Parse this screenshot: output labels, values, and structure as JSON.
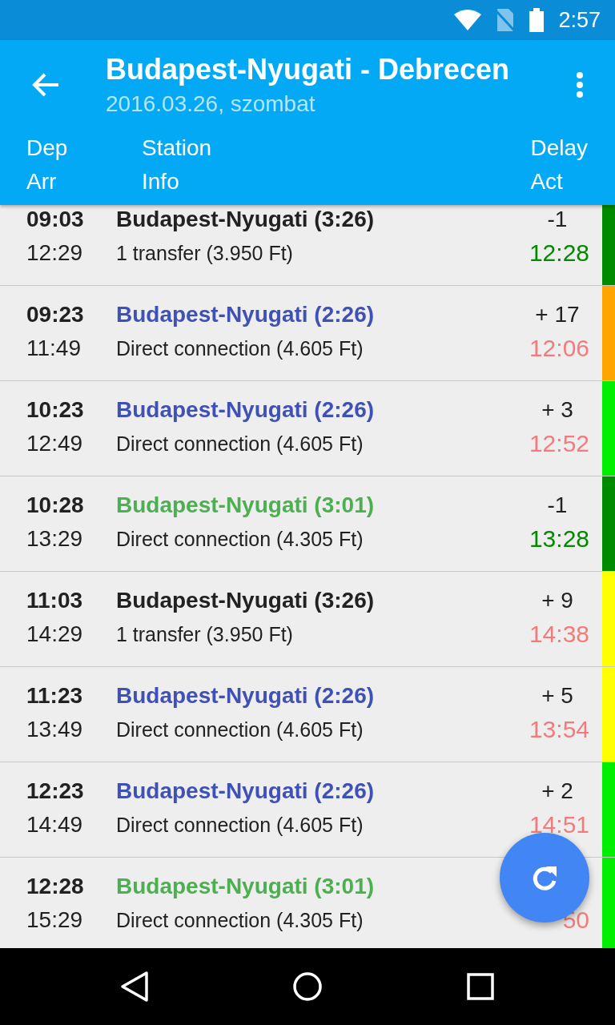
{
  "status_bar": {
    "time": "2:57"
  },
  "toolbar": {
    "title": "Budapest-Nyugati - Debrecen",
    "subtitle": "2016.03.26, szombat"
  },
  "columns": {
    "dep": "Dep",
    "arr": "Arr",
    "station": "Station",
    "info": "Info",
    "delay": "Delay",
    "act": "Act"
  },
  "rows": [
    {
      "dep": "09:03",
      "arr": "12:29",
      "station": "Budapest-Nyugati (3:26)",
      "kind": "neutral",
      "info": "1 transfer (3.950 Ft)",
      "delay": "-1",
      "act": "12:28",
      "late": false,
      "color": "#008a00"
    },
    {
      "dep": "09:23",
      "arr": "11:49",
      "station": "Budapest-Nyugati (2:26)",
      "kind": "blue",
      "info": "Direct connection (4.605 Ft)",
      "delay": "+ 17",
      "act": "12:06",
      "late": true,
      "color": "#ffa500"
    },
    {
      "dep": "10:23",
      "arr": "12:49",
      "station": "Budapest-Nyugati (2:26)",
      "kind": "blue",
      "info": "Direct connection (4.605 Ft)",
      "delay": "+ 3",
      "act": "12:52",
      "late": true,
      "color": "#00ee00"
    },
    {
      "dep": "10:28",
      "arr": "13:29",
      "station": "Budapest-Nyugati (3:01)",
      "kind": "green",
      "info": "Direct connection (4.305 Ft)",
      "delay": "-1",
      "act": "13:28",
      "late": false,
      "color": "#008a00"
    },
    {
      "dep": "11:03",
      "arr": "14:29",
      "station": "Budapest-Nyugati (3:26)",
      "kind": "neutral",
      "info": "1 transfer (3.950 Ft)",
      "delay": "+ 9",
      "act": "14:38",
      "late": true,
      "color": "#ffff00"
    },
    {
      "dep": "11:23",
      "arr": "13:49",
      "station": "Budapest-Nyugati (2:26)",
      "kind": "blue",
      "info": "Direct connection (4.605 Ft)",
      "delay": "+ 5",
      "act": "13:54",
      "late": true,
      "color": "#ffff00"
    },
    {
      "dep": "12:23",
      "arr": "14:49",
      "station": "Budapest-Nyugati (2:26)",
      "kind": "blue",
      "info": "Direct connection (4.605 Ft)",
      "delay": "+ 2",
      "act": "14:51",
      "late": true,
      "color": "#00ee00"
    },
    {
      "dep": "12:28",
      "arr": "15:29",
      "station": "Budapest-Nyugati (3:01)",
      "kind": "green",
      "info": "Direct connection (4.305 Ft)",
      "act": "50",
      "late": true,
      "color": "#00ee00"
    }
  ]
}
